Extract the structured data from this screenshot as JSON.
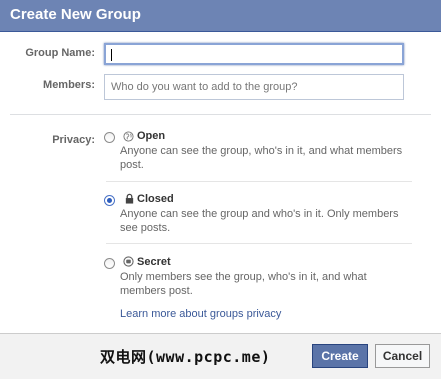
{
  "dialog": {
    "title": "Create New Group"
  },
  "form": {
    "group_name_label": "Group Name:",
    "group_name_value": "",
    "members_label": "Members:",
    "members_placeholder": "Who do you want to add to the group?",
    "privacy_label": "Privacy:"
  },
  "privacy_options": [
    {
      "title": "Open",
      "description": "Anyone can see the group, who's in it, and what members post.",
      "icon": "globe-icon",
      "selected": false
    },
    {
      "title": "Closed",
      "description": "Anyone can see the group and who's in it. Only members see posts.",
      "icon": "lock-icon",
      "selected": true
    },
    {
      "title": "Secret",
      "description": "Only members see the group, who's in it, and what members post.",
      "icon": "secret-icon",
      "selected": false
    }
  ],
  "learn_more_link": "Learn more about groups privacy",
  "footer": {
    "watermark": "双电网(www.pcpc.me)",
    "create_label": "Create",
    "cancel_label": "Cancel"
  },
  "colors": {
    "title_bar": "#6d84b4",
    "link": "#3b5998",
    "primary_button": "#5b74a8"
  }
}
